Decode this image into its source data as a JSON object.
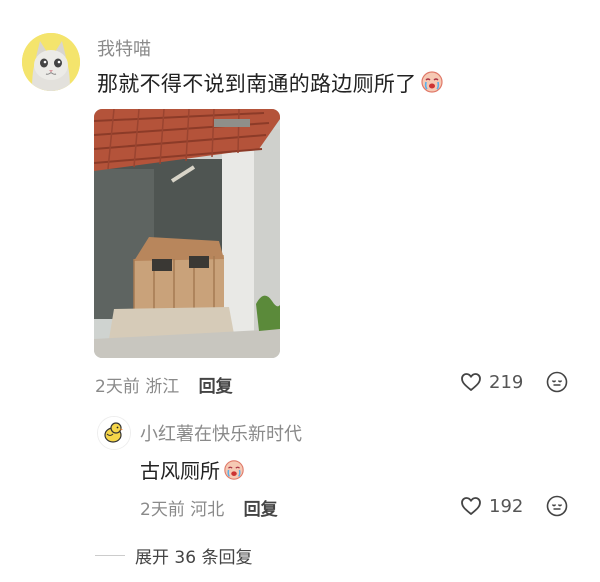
{
  "comment": {
    "username": "我特喵",
    "text": "那就不得不说到南通的路边厕所了",
    "emoji_icon": "crying-face-emoji",
    "meta": "2天前 浙江",
    "reply_label": "回复",
    "likes": "219",
    "like_icon": "heart-icon",
    "more_icon": "ellipsis-bubble-icon"
  },
  "reply": {
    "username": "小红薯在快乐新时代",
    "text": "古风厕所",
    "emoji_icon": "crying-face-emoji",
    "meta": "2天前 河北",
    "reply_label": "回复",
    "likes": "192",
    "like_icon": "heart-icon",
    "more_icon": "ellipsis-bubble-icon"
  },
  "expand": {
    "label": "展开 36 条回复"
  },
  "colors": {
    "roof": "#b4533a",
    "wall": "#e9e9e6",
    "wood": "#c9a27a"
  }
}
